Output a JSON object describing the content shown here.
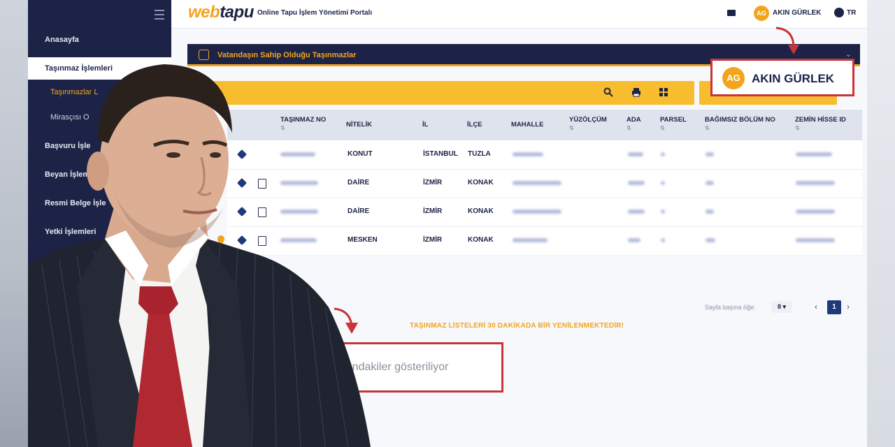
{
  "sidebar": {
    "items": [
      {
        "label": "Anasayfa"
      },
      {
        "label": "Taşınmaz İşlemleri"
      },
      {
        "label": "Başvuru İşle"
      },
      {
        "label": "Beyan İşlem"
      },
      {
        "label": "Resmi Belge İşle"
      },
      {
        "label": "Yetki İşlemleri"
      }
    ],
    "subitems": [
      {
        "label": "Taşınmazlar L"
      },
      {
        "label": "Mirasçısı O"
      }
    ]
  },
  "header": {
    "logo_a": "web",
    "logo_b": "tapu",
    "portal_title": "Online Tapu İşlem Yönetimi Portalı",
    "user_initials": "AG",
    "user_name": "AKIN GÜRLEK",
    "language": "TR"
  },
  "panel": {
    "title": "Vatandaşın Sahip Olduğu Taşınmazlar"
  },
  "table": {
    "columns": [
      "TAŞINMAZ NO",
      "NİTELİK",
      "İL",
      "İLÇE",
      "MAHALLE",
      "YÜZÖLÇÜM",
      "ADA",
      "PARSEL",
      "BAĞIMSIZ BÖLÜM NO",
      "ZEMİN HİSSE ID"
    ],
    "rows": [
      {
        "nitelik": "KONUT",
        "il": "İSTANBUL",
        "ilce": "TUZLA"
      },
      {
        "nitelik": "DAİRE",
        "il": "İZMİR",
        "ilce": "KONAK"
      },
      {
        "nitelik": "DAİRE",
        "il": "İZMİR",
        "ilce": "KONAK"
      },
      {
        "nitelik": "MESKEN",
        "il": "İZMİR",
        "ilce": "KONAK"
      }
    ]
  },
  "pagination": {
    "label": "Sayfa başına öğe:",
    "page_size": "8",
    "current_page": "1"
  },
  "notice": "TAŞINMAZ LİSTELERİ 30 DAKİKADA BİR YENİLENMEKTEDİR!",
  "callouts": {
    "user_initials": "AG",
    "user_name": "AKIN GÜRLEK",
    "note_fragment": "rasındakiler gösteriliyor"
  },
  "colors": {
    "navy": "#1d2346",
    "accent": "#f3a41d",
    "highlight_red": "#c7343a"
  }
}
